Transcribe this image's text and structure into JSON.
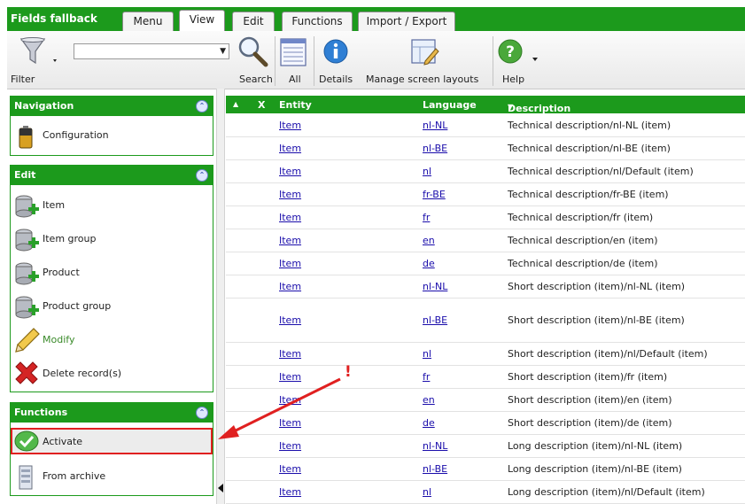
{
  "app_title": "Fields fallback",
  "tabs": [
    {
      "label": "Menu"
    },
    {
      "label": "View",
      "active": true
    },
    {
      "label": "Edit"
    },
    {
      "label": "Functions"
    },
    {
      "label": "Import / Export"
    }
  ],
  "toolbar": {
    "filter_label": "Filter",
    "filter_value": "",
    "search_label": "Search",
    "all_label": "All",
    "details_label": "Details",
    "manage_layouts_label": "Manage screen layouts",
    "help_label": "Help"
  },
  "navigation_panel": {
    "title": "Navigation",
    "items": [
      {
        "label": "Configuration",
        "icon": "battery-icon"
      }
    ]
  },
  "edit_panel": {
    "title": "Edit",
    "items": [
      {
        "label": "Item",
        "icon": "database-add-icon"
      },
      {
        "label": "Item group",
        "icon": "database-add-icon"
      },
      {
        "label": "Product",
        "icon": "database-add-icon"
      },
      {
        "label": "Product group",
        "icon": "database-add-icon"
      },
      {
        "label": "Modify",
        "icon": "pencil-icon"
      },
      {
        "label": "Delete record(s)",
        "icon": "red-x-icon"
      }
    ]
  },
  "functions_panel": {
    "title": "Functions",
    "items": [
      {
        "label": "Activate",
        "icon": "green-check-icon",
        "highlighted": true
      },
      {
        "label": "From archive",
        "icon": "archive-icon"
      }
    ]
  },
  "grid": {
    "columns": {
      "sort": "▲",
      "x": "X",
      "entity": "Entity",
      "language": "Language",
      "description": "Description"
    },
    "sorted_by": "Description",
    "rows": [
      {
        "entity": "Item",
        "language": "nl-NL",
        "description": "Technical description/nl-NL (item)"
      },
      {
        "entity": "Item",
        "language": "nl-BE",
        "description": "Technical description/nl-BE (item)"
      },
      {
        "entity": "Item",
        "language": "nl",
        "description": "Technical description/nl/Default (item)"
      },
      {
        "entity": "Item",
        "language": "fr-BE",
        "description": "Technical description/fr-BE (item)"
      },
      {
        "entity": "Item",
        "language": "fr",
        "description": "Technical description/fr (item)"
      },
      {
        "entity": "Item",
        "language": "en",
        "description": "Technical description/en (item)"
      },
      {
        "entity": "Item",
        "language": "de",
        "description": "Technical description/de (item)"
      },
      {
        "entity": "Item",
        "language": "nl-NL",
        "description": "Short description (item)/nl-NL (item)"
      },
      {
        "entity": "Item",
        "language": "nl-BE",
        "description": "Short description (item)/nl-BE (item)"
      },
      {
        "entity": "Item",
        "language": "nl",
        "description": "Short description (item)/nl/Default (item)"
      },
      {
        "entity": "Item",
        "language": "fr",
        "description": "Short description (item)/fr (item)"
      },
      {
        "entity": "Item",
        "language": "en",
        "description": "Short description (item)/en (item)"
      },
      {
        "entity": "Item",
        "language": "de",
        "description": "Short description (item)/de (item)"
      },
      {
        "entity": "Item",
        "language": "nl-NL",
        "description": "Long description (item)/nl-NL (item)"
      },
      {
        "entity": "Item",
        "language": "nl-BE",
        "description": "Long description (item)/nl-BE (item)"
      },
      {
        "entity": "Item",
        "language": "nl",
        "description": "Long description (item)/nl/Default (item)"
      }
    ]
  },
  "annotation": {
    "mark": "!",
    "color": "#e02020"
  },
  "colors": {
    "header_green": "#1c9a1c",
    "link_blue": "#1a0dab",
    "highlight_red": "#e02020"
  }
}
